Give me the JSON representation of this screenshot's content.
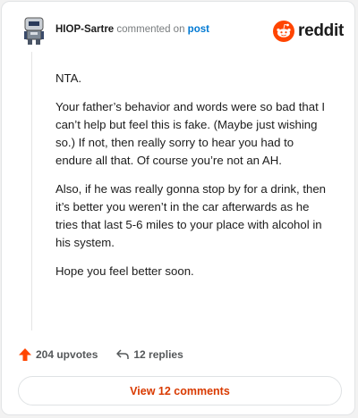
{
  "header": {
    "author": "HIOP-Sartre",
    "commented_text": "commented on",
    "post_link": "post",
    "brand": "reddit"
  },
  "comment": {
    "paragraphs": [
      "NTA.",
      "Your father’s behavior and words were so bad that I can’t help but feel this is fake. (Maybe just wishing so.) If not, then really sorry to hear you had to endure all that. Of course you’re not an AH.",
      "Also, if he was really gonna stop by for a drink, then it’s better you weren’t in the car afterwards as he tries that last 5-6 miles to your place with alcohol in his system.",
      "Hope you feel better soon."
    ]
  },
  "actions": {
    "upvotes": "204 upvotes",
    "replies": "12 replies"
  },
  "footer": {
    "view_comments": "View 12 comments"
  },
  "colors": {
    "brand_orange": "#ff4500",
    "link_blue": "#0079d3",
    "button_text": "#d93a00"
  },
  "icons": [
    "avatar",
    "reddit-logo-icon",
    "upvote-arrow-icon",
    "reply-arrow-icon"
  ]
}
